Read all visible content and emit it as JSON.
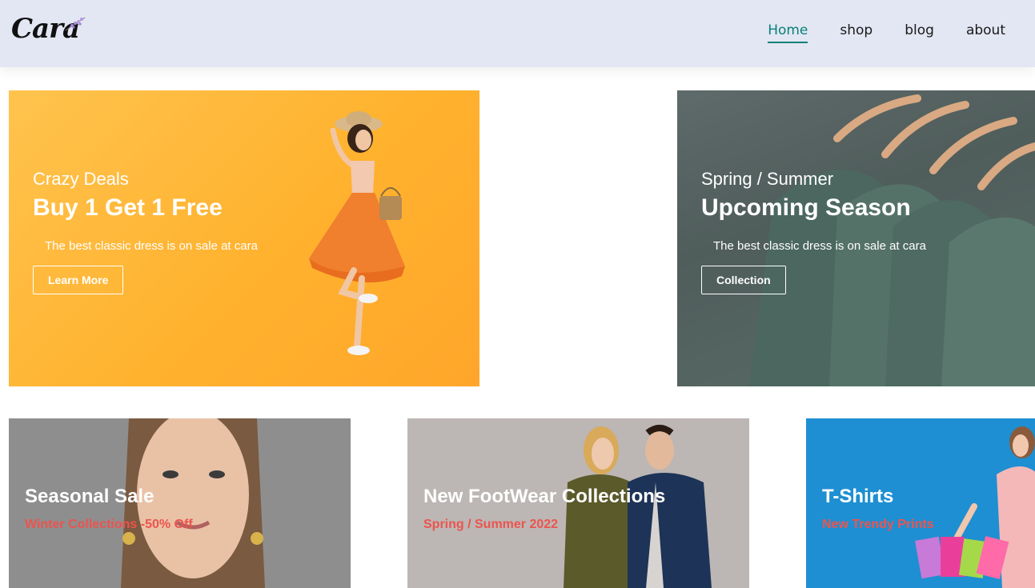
{
  "header": {
    "logo_text": "Cara",
    "nav": [
      {
        "label": "Home"
      },
      {
        "label": "shop"
      },
      {
        "label": "blog"
      },
      {
        "label": "about"
      }
    ]
  },
  "banners": [
    {
      "subtitle": "Crazy Deals",
      "title": "Buy 1 Get 1 Free",
      "description": "The best classic dress is on sale at cara",
      "button": "Learn More"
    },
    {
      "subtitle": "Spring / Summer",
      "title": "Upcoming Season",
      "description": "The best classic dress is on sale at cara",
      "button": "Collection"
    }
  ],
  "small_banners": [
    {
      "title": "Seasonal Sale",
      "subtitle": "Winter Collections -50% Off"
    },
    {
      "title": "New FootWear Collections",
      "subtitle": "Spring / Summer 2022"
    },
    {
      "title": "T-Shirts",
      "subtitle": "New Trendy Prints"
    }
  ],
  "colors": {
    "header_bg": "#e3e6f3",
    "accent": "#088178",
    "sale_red": "#ec544e"
  }
}
